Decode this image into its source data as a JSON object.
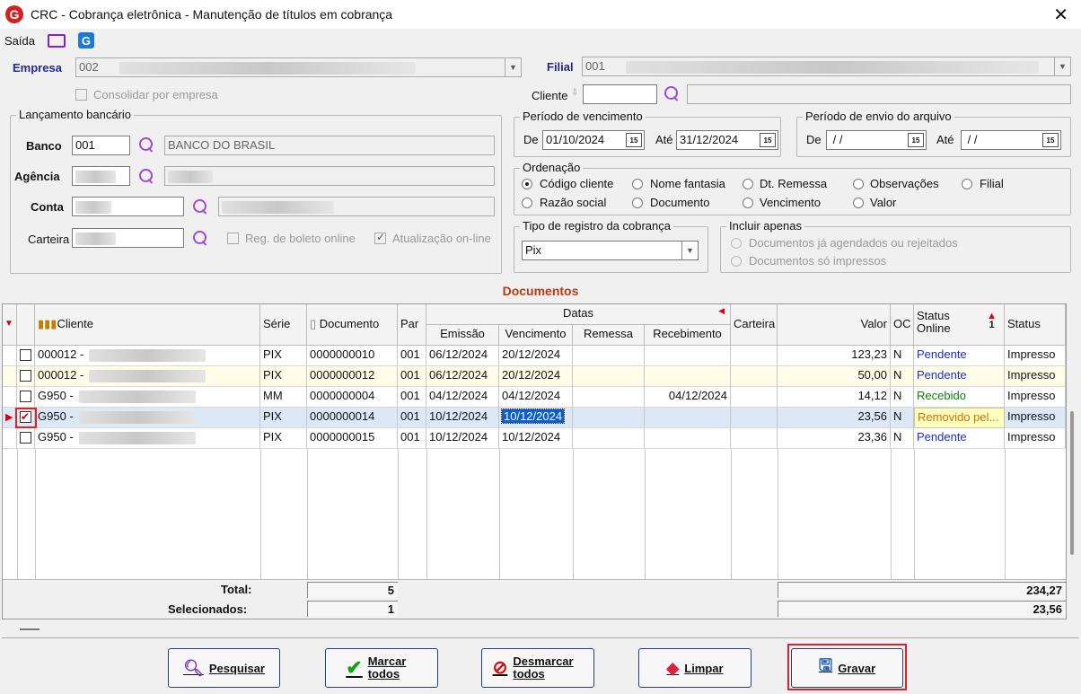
{
  "window": {
    "title": "CRC - Cobrança eletrônica - Manutenção de títulos em cobrança",
    "close": "✕"
  },
  "menu": {
    "saida": "Saída"
  },
  "empresa": {
    "label": "Empresa",
    "value": "002",
    "consolidar": "Consolidar por empresa"
  },
  "filial": {
    "label": "Filial",
    "value": "001"
  },
  "cliente": {
    "label": "Cliente"
  },
  "lancamento": {
    "title": "Lançamento bancário",
    "banco_label": "Banco",
    "banco_value": "001",
    "banco_nome": "BANCO DO BRASIL",
    "agencia_label": "Agência",
    "conta_label": "Conta",
    "carteira_label": "Carteira",
    "reg_boleto": "Reg. de boleto online",
    "atualizacao": "Atualização on-line"
  },
  "vencimento": {
    "title": "Período de vencimento",
    "de_label": "De",
    "de": "01/10/2024",
    "ate_label": "Até",
    "ate": "31/12/2024",
    "cal": "15"
  },
  "envio": {
    "title": "Período de envio do arquivo",
    "de_label": "De",
    "de": " / /",
    "ate_label": "Até",
    "ate": " / /",
    "cal": "15"
  },
  "ordenacao": {
    "title": "Ordenação",
    "options": [
      "Código cliente",
      "Nome fantasia",
      "Dt. Remessa",
      "Observações",
      "Filial",
      "Razão social",
      "Documento",
      "Vencimento",
      "Valor"
    ],
    "selected": "Código cliente"
  },
  "tipo_registro": {
    "title": "Tipo de registro da cobrança",
    "value": "Pix"
  },
  "incluir": {
    "title": "Incluir apenas",
    "opt1": "Documentos já agendados ou rejeitados",
    "opt2": "Documentos só impressos"
  },
  "documentos": {
    "title": "Documentos",
    "headers": {
      "cliente": "Cliente",
      "serie": "Série",
      "documento": "Documento",
      "par": "Par",
      "datas": "Datas",
      "emissao": "Emissão",
      "vencimento": "Vencimento",
      "remessa": "Remessa",
      "recebimento": "Recebimento",
      "carteira": "Carteira",
      "valor": "Valor",
      "oc": "OC",
      "status_online": "Status Online",
      "status": "Status",
      "sort_num": "1"
    },
    "rows": [
      {
        "checked": false,
        "cliente": "000012 -",
        "serie": "PIX",
        "documento": "0000000010",
        "par": "001",
        "emissao": "06/12/2024",
        "vencimento": "20/12/2024",
        "remessa": "",
        "recebimento": "",
        "carteira": "",
        "valor": "123,23",
        "oc": "N",
        "status_online": "Pendente",
        "status": "Impresso"
      },
      {
        "checked": false,
        "cliente": "000012 -",
        "serie": "PIX",
        "documento": "0000000012",
        "par": "001",
        "emissao": "06/12/2024",
        "vencimento": "20/12/2024",
        "remessa": "",
        "recebimento": "",
        "carteira": "",
        "valor": "50,00",
        "oc": "N",
        "status_online": "Pendente",
        "status": "Impresso"
      },
      {
        "checked": false,
        "cliente": "G950 -",
        "serie": "MM",
        "documento": "0000000004",
        "par": "001",
        "emissao": "04/12/2024",
        "vencimento": "04/12/2024",
        "remessa": "",
        "recebimento": "04/12/2024",
        "carteira": "",
        "valor": "14,12",
        "oc": "N",
        "status_online": "Recebido",
        "status": "Impresso"
      },
      {
        "checked": true,
        "cliente": "G950 -",
        "serie": "PIX",
        "documento": "0000000014",
        "par": "001",
        "emissao": "10/12/2024",
        "vencimento": "10/12/2024",
        "remessa": "",
        "recebimento": "",
        "carteira": "",
        "valor": "23,56",
        "oc": "N",
        "status_online": "Removido pel...",
        "status": "Impresso"
      },
      {
        "checked": false,
        "cliente": "G950 -",
        "serie": "PIX",
        "documento": "0000000015",
        "par": "001",
        "emissao": "10/12/2024",
        "vencimento": "10/12/2024",
        "remessa": "",
        "recebimento": "",
        "carteira": "",
        "valor": "23,36",
        "oc": "N",
        "status_online": "Pendente",
        "status": "Impresso"
      }
    ],
    "total_label": "Total:",
    "total_count": "5",
    "total_valor": "234,27",
    "sel_label": "Selecionados:",
    "sel_count": "1",
    "sel_valor": "23,56"
  },
  "buttons": {
    "pesquisar": "Pesquisar",
    "marcar": "Marcar todos",
    "desmarcar": "Desmarcar todos",
    "limpar": "Limpar",
    "gravar": "Gravar"
  },
  "colors": {
    "accent": "#1f2b8e",
    "section": "#b83a12",
    "pendente": "#1a2fcf",
    "recebido": "#108010",
    "removido": "#d07000"
  }
}
